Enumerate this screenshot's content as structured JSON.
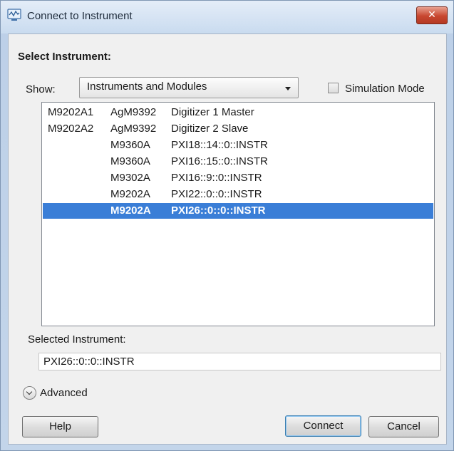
{
  "window": {
    "title": "Connect to Instrument",
    "close_glyph": "✕"
  },
  "dialog": {
    "section_title": "Select Instrument:",
    "show_label": "Show:",
    "show_value": "Instruments and Modules",
    "simulation_mode_label": "Simulation Mode",
    "simulation_mode_checked": false
  },
  "instruments": [
    {
      "col1": "M9202A1",
      "col2": "AgM9392",
      "col3": "Digitizer 1 Master",
      "selected": false
    },
    {
      "col1": "M9202A2",
      "col2": "AgM9392",
      "col3": "Digitizer 2 Slave",
      "selected": false
    },
    {
      "col1": "",
      "col2": "M9360A",
      "col3": "PXI18::14::0::INSTR",
      "selected": false
    },
    {
      "col1": "",
      "col2": "M9360A",
      "col3": "PXI16::15::0::INSTR",
      "selected": false
    },
    {
      "col1": "",
      "col2": "M9302A",
      "col3": "PXI16::9::0::INSTR",
      "selected": false
    },
    {
      "col1": "",
      "col2": "M9202A",
      "col3": "PXI22::0::0::INSTR",
      "selected": false
    },
    {
      "col1": "",
      "col2": "M9202A",
      "col3": "PXI26::0::0::INSTR",
      "selected": true
    }
  ],
  "selected": {
    "label": "Selected Instrument:",
    "value": "PXI26::0::0::INSTR"
  },
  "advanced": {
    "label": "Advanced"
  },
  "buttons": {
    "help": "Help",
    "connect": "Connect",
    "cancel": "Cancel"
  },
  "colors": {
    "selection": "#3a7ed7",
    "close_button": "#c8462f"
  },
  "icons": {
    "title": "instrument-connect-icon",
    "close": "close-icon",
    "dropdown": "chevron-down-icon",
    "advanced": "expand-circle-icon"
  }
}
